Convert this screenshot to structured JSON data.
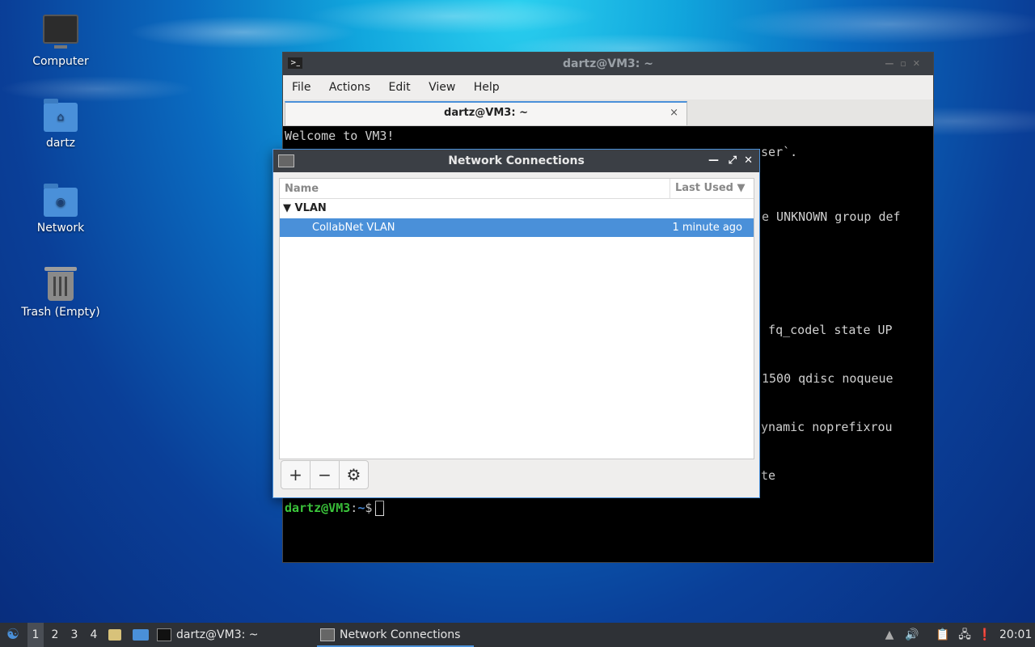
{
  "desktop": {
    "icons": [
      {
        "label": "Computer",
        "icon": "computer-icon"
      },
      {
        "label": "dartz",
        "icon": "home-folder-icon"
      },
      {
        "label": "Network",
        "icon": "network-folder-icon"
      },
      {
        "label": "Trash (Empty)",
        "icon": "trash-icon"
      }
    ]
  },
  "terminal": {
    "title": "dartz@VM3: ~",
    "menu": [
      "File",
      "Actions",
      "Edit",
      "View",
      "Help"
    ],
    "tab_label": "dartz@VM3: ~",
    "tab_close": "×",
    "lines": {
      "l1": "Welcome to VM3!",
      "l2": "user`.",
      "l3": "e UNKNOWN group def",
      "l4": "t fq_codel state UP",
      "l5": "1500 qdisc noqueue",
      "l6": "dynamic noprefixrou",
      "l7": "ute"
    },
    "prompt_user": "dartz@VM3",
    "prompt_sep": ":",
    "prompt_path": "~",
    "prompt_symbol": "$"
  },
  "network_dialog": {
    "title": "Network Connections",
    "columns": {
      "name": "Name",
      "last_used": "Last Used"
    },
    "groups": [
      {
        "label": "VLAN",
        "connections": [
          {
            "name": "CollabNet VLAN",
            "last_used": "1 minute ago",
            "selected": true
          }
        ]
      }
    ],
    "tools": {
      "add": "+",
      "remove": "−",
      "settings": "⚙"
    }
  },
  "taskbar": {
    "workspaces": [
      "1",
      "2",
      "3",
      "4"
    ],
    "active_workspace": "1",
    "tasks": [
      {
        "label": "dartz@VM3: ~",
        "icon": "terminal-icon"
      },
      {
        "label": "Network Connections",
        "icon": "network-icon",
        "active": true
      }
    ],
    "clock": "20:01"
  },
  "colors": {
    "accent": "#4a90d9",
    "titlebar": "#3b3f45",
    "prompt_green": "#3fd13f"
  }
}
